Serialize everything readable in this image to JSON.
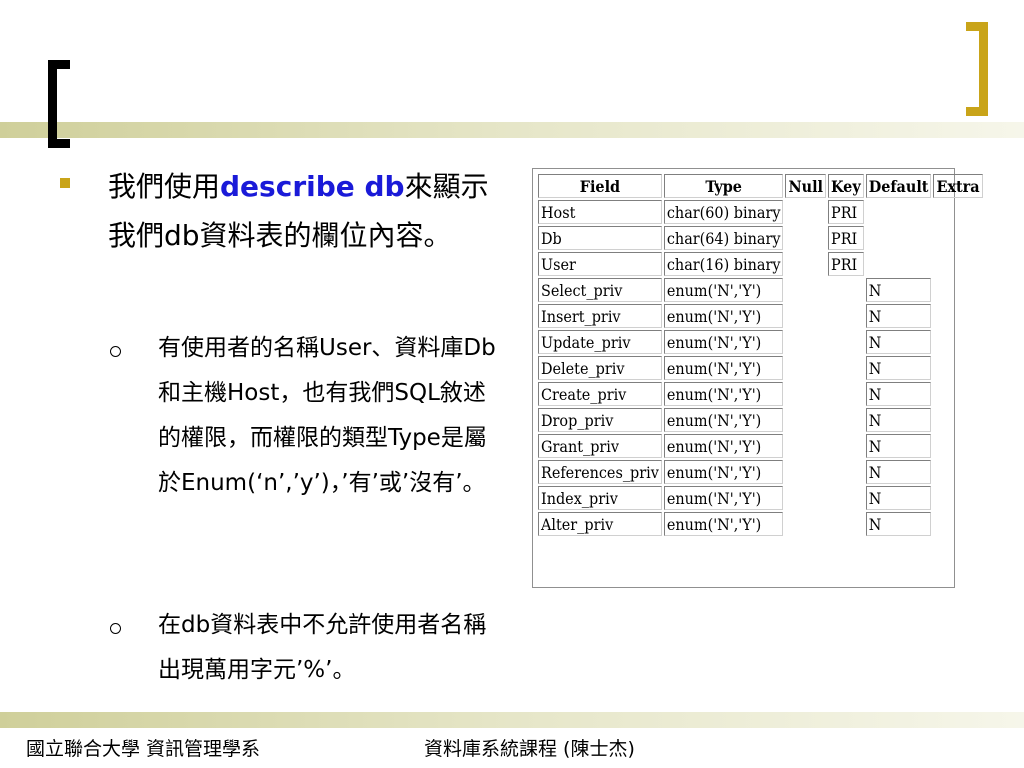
{
  "slide": {
    "bullet_main_prefix": "我們使用",
    "bullet_main_keyword": "describe db",
    "bullet_main_suffix": "來顯示我們db資料表的欄位內容。",
    "sub_bullet_1": "有使用者的名稱User、資料庫Db和主機Host，也有我們SQL敘述的權限，而權限的類型Type是屬於Enum(‘n’,’y’)，’有’或’沒有’。",
    "sub_bullet_2": "在db資料表中不允許使用者名稱出現萬用字元’%’。"
  },
  "table": {
    "headers": [
      "Field",
      "Type",
      "Null",
      "Key",
      "Default",
      "Extra"
    ],
    "rows": [
      {
        "field": "Host",
        "type": "char(60) binary",
        "null": "",
        "key": "PRI",
        "default": ""
      },
      {
        "field": "Db",
        "type": "char(64) binary",
        "null": "",
        "key": "PRI",
        "default": ""
      },
      {
        "field": "User",
        "type": "char(16) binary",
        "null": "",
        "key": "PRI",
        "default": ""
      },
      {
        "field": "Select_priv",
        "type": "enum('N','Y')",
        "null": "",
        "key": "",
        "default": "N"
      },
      {
        "field": "Insert_priv",
        "type": "enum('N','Y')",
        "null": "",
        "key": "",
        "default": "N"
      },
      {
        "field": "Update_priv",
        "type": "enum('N','Y')",
        "null": "",
        "key": "",
        "default": "N"
      },
      {
        "field": "Delete_priv",
        "type": "enum('N','Y')",
        "null": "",
        "key": "",
        "default": "N"
      },
      {
        "field": "Create_priv",
        "type": "enum('N','Y')",
        "null": "",
        "key": "",
        "default": "N"
      },
      {
        "field": "Drop_priv",
        "type": "enum('N','Y')",
        "null": "",
        "key": "",
        "default": "N"
      },
      {
        "field": "Grant_priv",
        "type": "enum('N','Y')",
        "null": "",
        "key": "",
        "default": "N"
      },
      {
        "field": "References_priv",
        "type": "enum('N','Y')",
        "null": "",
        "key": "",
        "default": "N"
      },
      {
        "field": "Index_priv",
        "type": "enum('N','Y')",
        "null": "",
        "key": "",
        "default": "N"
      },
      {
        "field": "Alter_priv",
        "type": "enum('N','Y')",
        "null": "",
        "key": "",
        "default": "N"
      }
    ]
  },
  "footer": {
    "left": "國立聯合大學 資訊管理學系",
    "center": "資料庫系統課程 (陳士杰)"
  },
  "colors": {
    "accent_gold": "#c9a419",
    "keyword_blue": "#1a1ad8",
    "line_olive": "#cfcf9a"
  }
}
